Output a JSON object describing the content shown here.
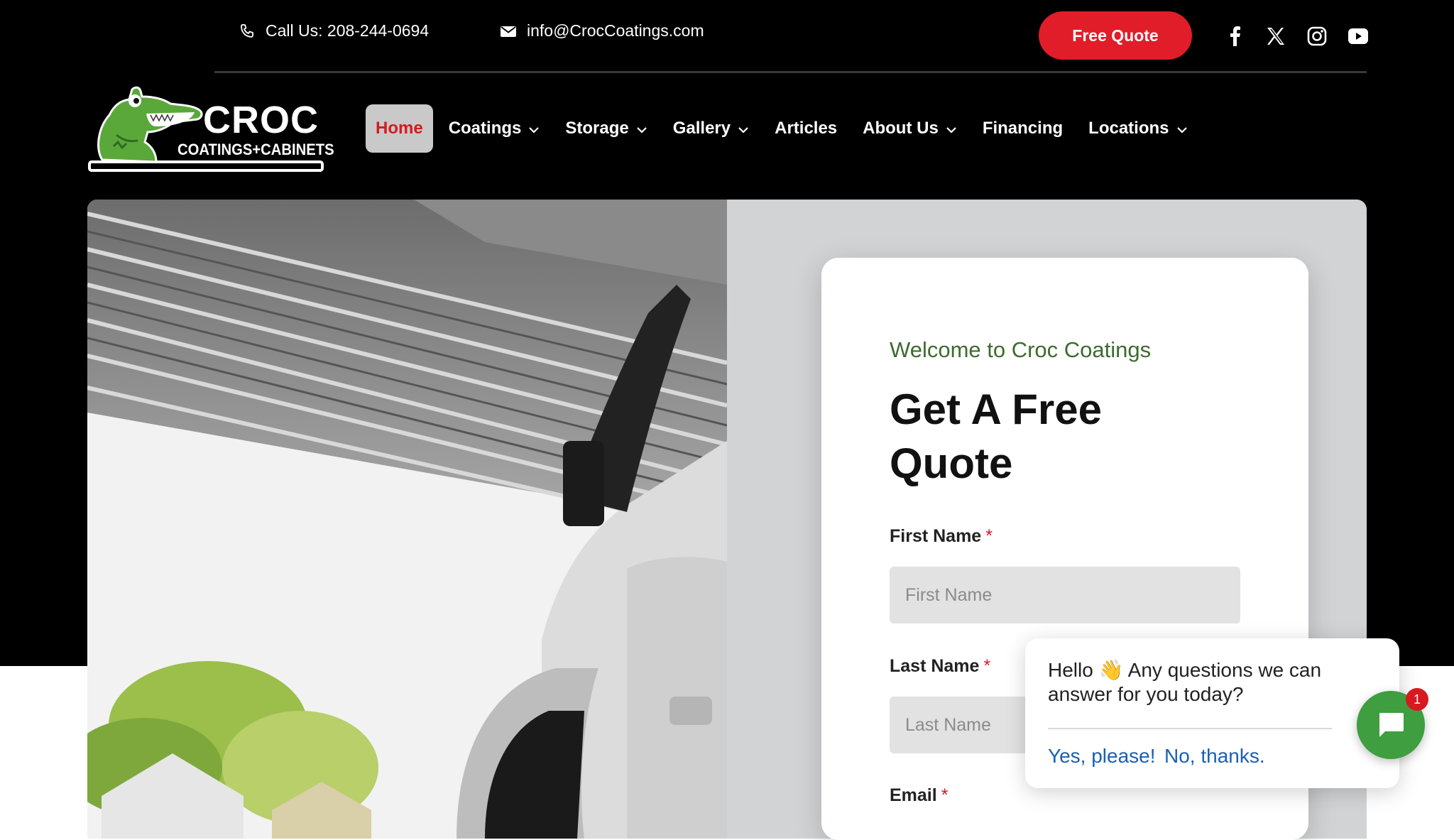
{
  "topbar": {
    "phone_text": "Call Us: 208-244-0694",
    "email_text": "info@CrocCoatings.com",
    "quote_button": "Free Quote",
    "social_icons": [
      "facebook-icon",
      "x-icon",
      "instagram-icon",
      "youtube-icon"
    ]
  },
  "logo": {
    "title": "CROC",
    "subtitle": "COATINGS+CABINETS"
  },
  "nav": {
    "items": [
      {
        "label": "Home",
        "active": true,
        "dropdown": false
      },
      {
        "label": "Coatings",
        "dropdown": true
      },
      {
        "label": "Storage",
        "dropdown": true
      },
      {
        "label": "Gallery",
        "dropdown": true
      },
      {
        "label": "Articles",
        "dropdown": false
      },
      {
        "label": "About Us",
        "dropdown": true
      },
      {
        "label": "Financing",
        "dropdown": false
      },
      {
        "label": "Locations",
        "dropdown": true
      }
    ]
  },
  "form": {
    "welcome": "Welcome to Croc Coatings",
    "title": "Get A Free Quote",
    "first_name_label": "First Name",
    "first_name_placeholder": "First Name",
    "last_name_label": "Last Name",
    "last_name_placeholder": "Last Name",
    "email_label": "Email",
    "required_mark": "*"
  },
  "chat": {
    "message": "Hello 👋 Any questions we can answer for you today?",
    "yes": "Yes, please!",
    "no": "No, thanks.",
    "badge_count": "1"
  },
  "colors": {
    "brand_red": "#e11d29",
    "brand_green": "#3d6b2f",
    "chat_green": "#3f9e3f",
    "link_blue": "#1a5fb4"
  }
}
